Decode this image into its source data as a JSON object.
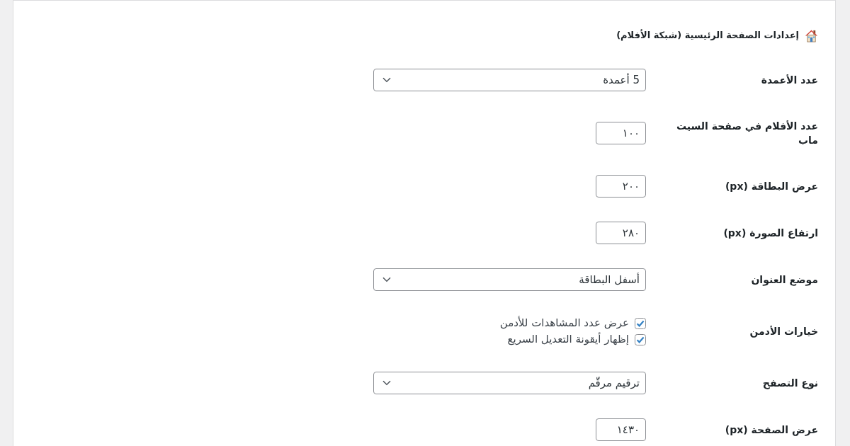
{
  "section": {
    "title": "إعدادات الصفحة الرئيسية (شبكة الأفلام)"
  },
  "settings": [
    {
      "kind": "select",
      "label": "عدد الأعمدة",
      "value": "5 أعمدة"
    },
    {
      "kind": "number",
      "label": "عدد الأفلام في صفحة السيت ماب",
      "value": "١٠٠"
    },
    {
      "kind": "number",
      "label": "عرض البطاقة (px)",
      "value": "٢٠٠"
    },
    {
      "kind": "number",
      "label": "ارتفاع الصورة (px)",
      "value": "٢٨٠"
    },
    {
      "kind": "select",
      "label": "موضع العنوان",
      "value": "أسفل البطاقة"
    },
    {
      "kind": "checkboxes",
      "label": "خيارات الأدمن",
      "options": [
        {
          "label": "عرض عدد المشاهدات للأدمن",
          "checked": true
        },
        {
          "label": "إظهار أيقونة التعديل السريع",
          "checked": true
        }
      ]
    },
    {
      "kind": "select",
      "label": "نوع التصفح",
      "value": "ترقيم مرقّم"
    },
    {
      "kind": "number",
      "label": "عرض الصفحة (px)",
      "value": "١٤٣٠"
    }
  ]
}
